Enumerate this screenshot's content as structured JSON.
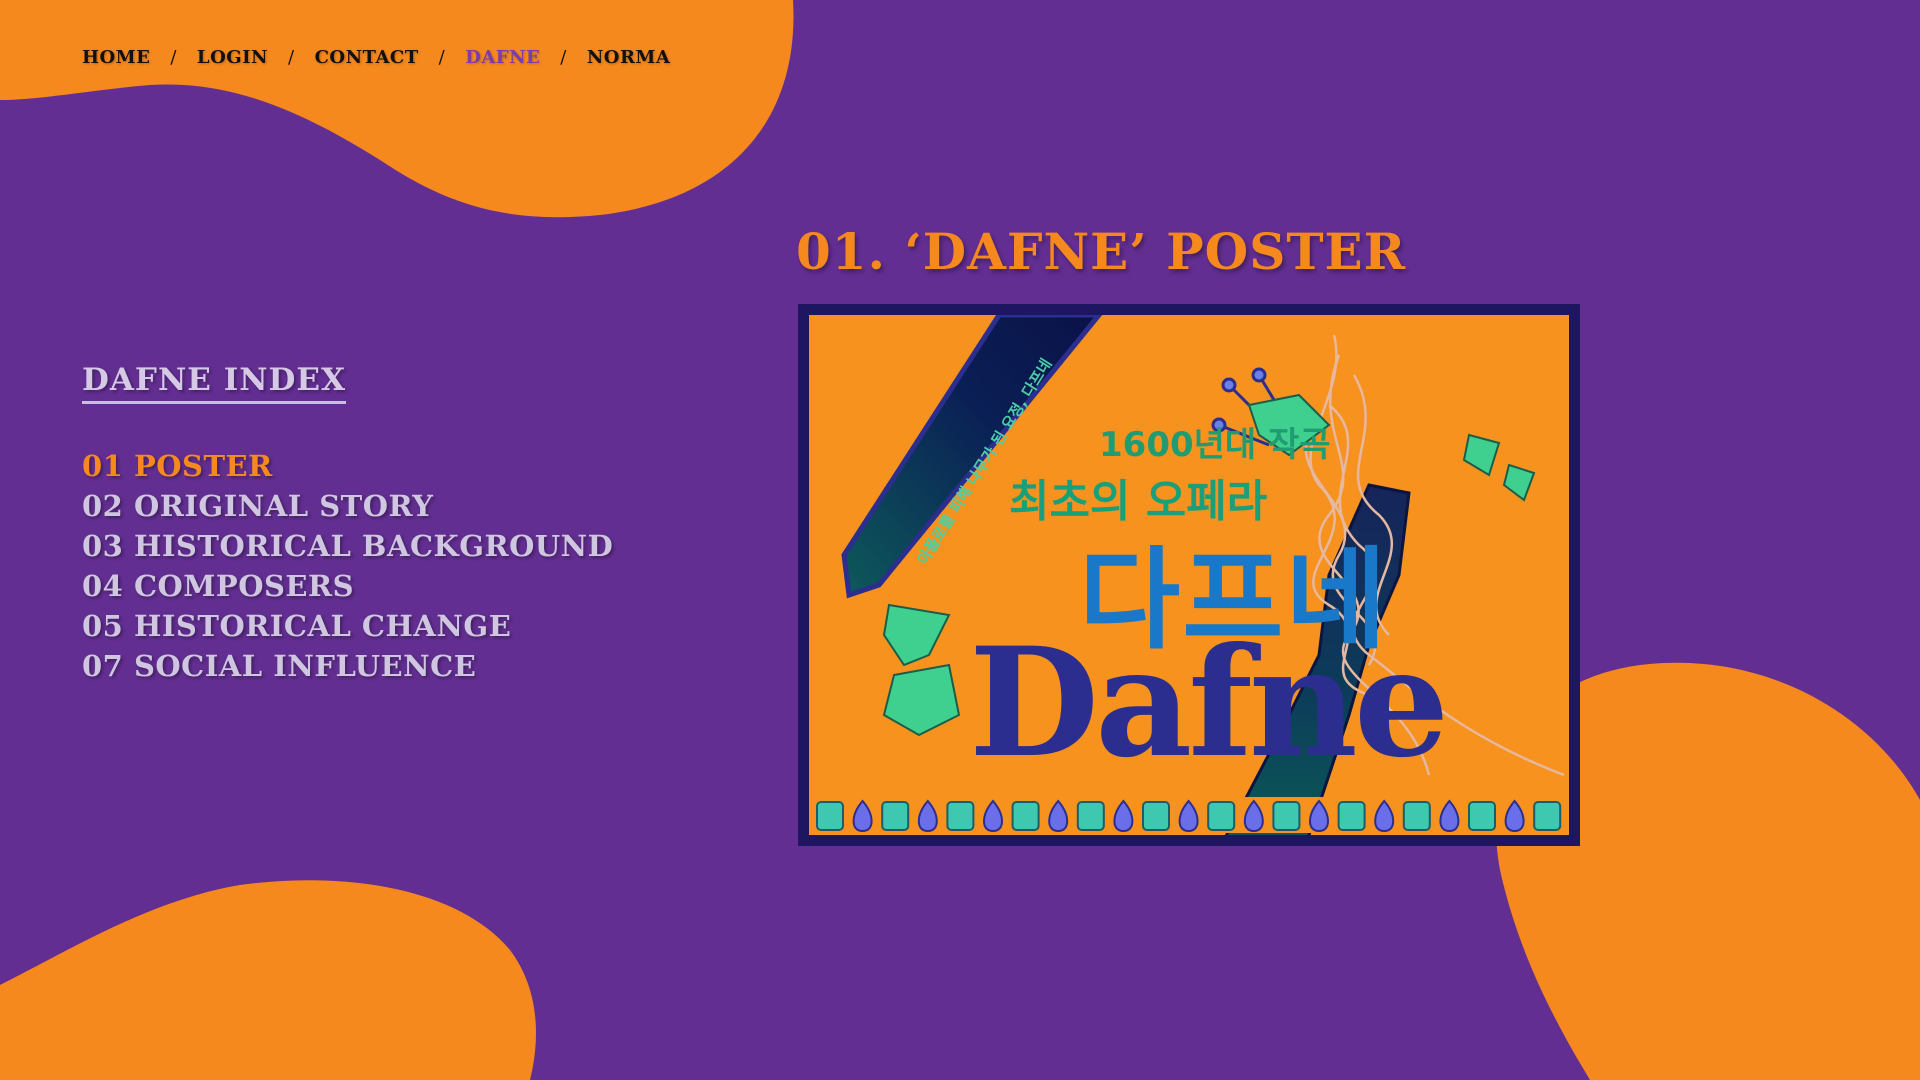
{
  "nav": {
    "items": [
      {
        "label": "HOME"
      },
      {
        "label": "LOGIN"
      },
      {
        "label": "CONTACT"
      },
      {
        "label": "DAFNE"
      },
      {
        "label": "NORMA"
      }
    ],
    "separator": "/",
    "active": "DAFNE"
  },
  "index": {
    "title": "DAFNE INDEX",
    "items": [
      {
        "label": "01 POSTER"
      },
      {
        "label": "02 ORIGINAL STORY"
      },
      {
        "label": "03 HISTORICAL BACKGROUND"
      },
      {
        "label": "04 COMPOSERS"
      },
      {
        "label": "05 HISTORICAL CHANGE"
      },
      {
        "label": "07 SOCIAL INFLUENCE"
      }
    ]
  },
  "section": {
    "title": "01. ‘DAFNE’ POSTER"
  },
  "poster": {
    "year_line": "1600년대 작곡",
    "opera_line": "최초의 오페라",
    "korean_title": "다프네",
    "latin_title": "Dafne",
    "ribbon_text": "아폴로를 피해 나무가 된 요정, 다프네"
  },
  "colors": {
    "background": "#632e92",
    "accent_orange": "#f5891e",
    "menu_text": "#cfc6df",
    "active_nav": "#7a3cb0",
    "poster_frame": "#1e1660"
  }
}
